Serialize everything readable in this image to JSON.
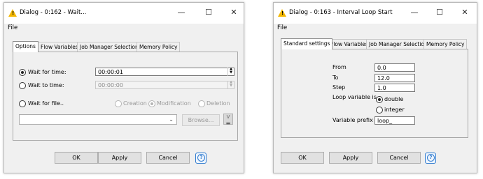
{
  "left": {
    "title": "Dialog - 0:162 - Wait...",
    "menu_file": "File",
    "tabs": [
      "Options",
      "Flow Variables",
      "Job Manager Selection",
      "Memory Policy"
    ],
    "wait_for_time_label": "Wait for time:",
    "wait_for_time_value": "00:00:01",
    "wait_to_time_label": "Wait to time:",
    "wait_to_time_value": "00:00:00",
    "wait_for_file_label": "Wait for file..",
    "file_options": [
      "Creation",
      "Modification",
      "Deletion"
    ],
    "browse_label": "Browse...",
    "buttons": {
      "ok": "OK",
      "apply": "Apply",
      "cancel": "Cancel"
    },
    "help": "?"
  },
  "right": {
    "title": "Dialog - 0:163 - Interval Loop Start",
    "menu_file": "File",
    "tabs": [
      "Standard settings",
      "Flow Variables",
      "Job Manager Selection",
      "Memory Policy"
    ],
    "from_label": "From",
    "from_value": "0.0",
    "to_label": "To",
    "to_value": "12.0",
    "step_label": "Step",
    "step_value": "1.0",
    "loop_var_label": "Loop variable is",
    "loop_var_options": [
      "double",
      "integer"
    ],
    "prefix_label": "Variable prefix",
    "prefix_value": "loop_",
    "buttons": {
      "ok": "OK",
      "apply": "Apply",
      "cancel": "Cancel"
    },
    "help": "?"
  },
  "window_controls": {
    "minimize": "—",
    "maximize": "☐",
    "close": "✕"
  },
  "colors": {
    "warning_icon": "#f3b700",
    "help_accent": "#2f7bd0"
  }
}
